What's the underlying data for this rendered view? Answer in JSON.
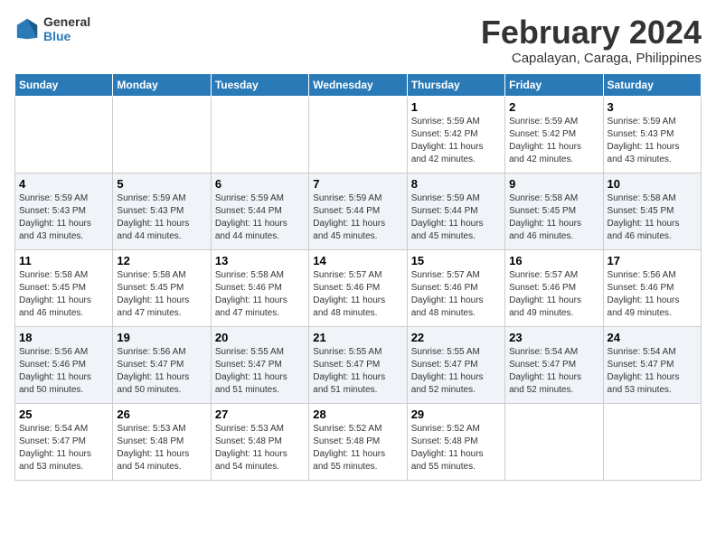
{
  "header": {
    "logo_line1": "General",
    "logo_line2": "Blue",
    "title": "February 2024",
    "subtitle": "Capalayan, Caraga, Philippines"
  },
  "days_of_week": [
    "Sunday",
    "Monday",
    "Tuesday",
    "Wednesday",
    "Thursday",
    "Friday",
    "Saturday"
  ],
  "weeks": [
    [
      {
        "day": "",
        "info": ""
      },
      {
        "day": "",
        "info": ""
      },
      {
        "day": "",
        "info": ""
      },
      {
        "day": "",
        "info": ""
      },
      {
        "day": "1",
        "info": "Sunrise: 5:59 AM\nSunset: 5:42 PM\nDaylight: 11 hours\nand 42 minutes."
      },
      {
        "day": "2",
        "info": "Sunrise: 5:59 AM\nSunset: 5:42 PM\nDaylight: 11 hours\nand 42 minutes."
      },
      {
        "day": "3",
        "info": "Sunrise: 5:59 AM\nSunset: 5:43 PM\nDaylight: 11 hours\nand 43 minutes."
      }
    ],
    [
      {
        "day": "4",
        "info": "Sunrise: 5:59 AM\nSunset: 5:43 PM\nDaylight: 11 hours\nand 43 minutes."
      },
      {
        "day": "5",
        "info": "Sunrise: 5:59 AM\nSunset: 5:43 PM\nDaylight: 11 hours\nand 44 minutes."
      },
      {
        "day": "6",
        "info": "Sunrise: 5:59 AM\nSunset: 5:44 PM\nDaylight: 11 hours\nand 44 minutes."
      },
      {
        "day": "7",
        "info": "Sunrise: 5:59 AM\nSunset: 5:44 PM\nDaylight: 11 hours\nand 45 minutes."
      },
      {
        "day": "8",
        "info": "Sunrise: 5:59 AM\nSunset: 5:44 PM\nDaylight: 11 hours\nand 45 minutes."
      },
      {
        "day": "9",
        "info": "Sunrise: 5:58 AM\nSunset: 5:45 PM\nDaylight: 11 hours\nand 46 minutes."
      },
      {
        "day": "10",
        "info": "Sunrise: 5:58 AM\nSunset: 5:45 PM\nDaylight: 11 hours\nand 46 minutes."
      }
    ],
    [
      {
        "day": "11",
        "info": "Sunrise: 5:58 AM\nSunset: 5:45 PM\nDaylight: 11 hours\nand 46 minutes."
      },
      {
        "day": "12",
        "info": "Sunrise: 5:58 AM\nSunset: 5:45 PM\nDaylight: 11 hours\nand 47 minutes."
      },
      {
        "day": "13",
        "info": "Sunrise: 5:58 AM\nSunset: 5:46 PM\nDaylight: 11 hours\nand 47 minutes."
      },
      {
        "day": "14",
        "info": "Sunrise: 5:57 AM\nSunset: 5:46 PM\nDaylight: 11 hours\nand 48 minutes."
      },
      {
        "day": "15",
        "info": "Sunrise: 5:57 AM\nSunset: 5:46 PM\nDaylight: 11 hours\nand 48 minutes."
      },
      {
        "day": "16",
        "info": "Sunrise: 5:57 AM\nSunset: 5:46 PM\nDaylight: 11 hours\nand 49 minutes."
      },
      {
        "day": "17",
        "info": "Sunrise: 5:56 AM\nSunset: 5:46 PM\nDaylight: 11 hours\nand 49 minutes."
      }
    ],
    [
      {
        "day": "18",
        "info": "Sunrise: 5:56 AM\nSunset: 5:46 PM\nDaylight: 11 hours\nand 50 minutes."
      },
      {
        "day": "19",
        "info": "Sunrise: 5:56 AM\nSunset: 5:47 PM\nDaylight: 11 hours\nand 50 minutes."
      },
      {
        "day": "20",
        "info": "Sunrise: 5:55 AM\nSunset: 5:47 PM\nDaylight: 11 hours\nand 51 minutes."
      },
      {
        "day": "21",
        "info": "Sunrise: 5:55 AM\nSunset: 5:47 PM\nDaylight: 11 hours\nand 51 minutes."
      },
      {
        "day": "22",
        "info": "Sunrise: 5:55 AM\nSunset: 5:47 PM\nDaylight: 11 hours\nand 52 minutes."
      },
      {
        "day": "23",
        "info": "Sunrise: 5:54 AM\nSunset: 5:47 PM\nDaylight: 11 hours\nand 52 minutes."
      },
      {
        "day": "24",
        "info": "Sunrise: 5:54 AM\nSunset: 5:47 PM\nDaylight: 11 hours\nand 53 minutes."
      }
    ],
    [
      {
        "day": "25",
        "info": "Sunrise: 5:54 AM\nSunset: 5:47 PM\nDaylight: 11 hours\nand 53 minutes."
      },
      {
        "day": "26",
        "info": "Sunrise: 5:53 AM\nSunset: 5:48 PM\nDaylight: 11 hours\nand 54 minutes."
      },
      {
        "day": "27",
        "info": "Sunrise: 5:53 AM\nSunset: 5:48 PM\nDaylight: 11 hours\nand 54 minutes."
      },
      {
        "day": "28",
        "info": "Sunrise: 5:52 AM\nSunset: 5:48 PM\nDaylight: 11 hours\nand 55 minutes."
      },
      {
        "day": "29",
        "info": "Sunrise: 5:52 AM\nSunset: 5:48 PM\nDaylight: 11 hours\nand 55 minutes."
      },
      {
        "day": "",
        "info": ""
      },
      {
        "day": "",
        "info": ""
      }
    ]
  ]
}
